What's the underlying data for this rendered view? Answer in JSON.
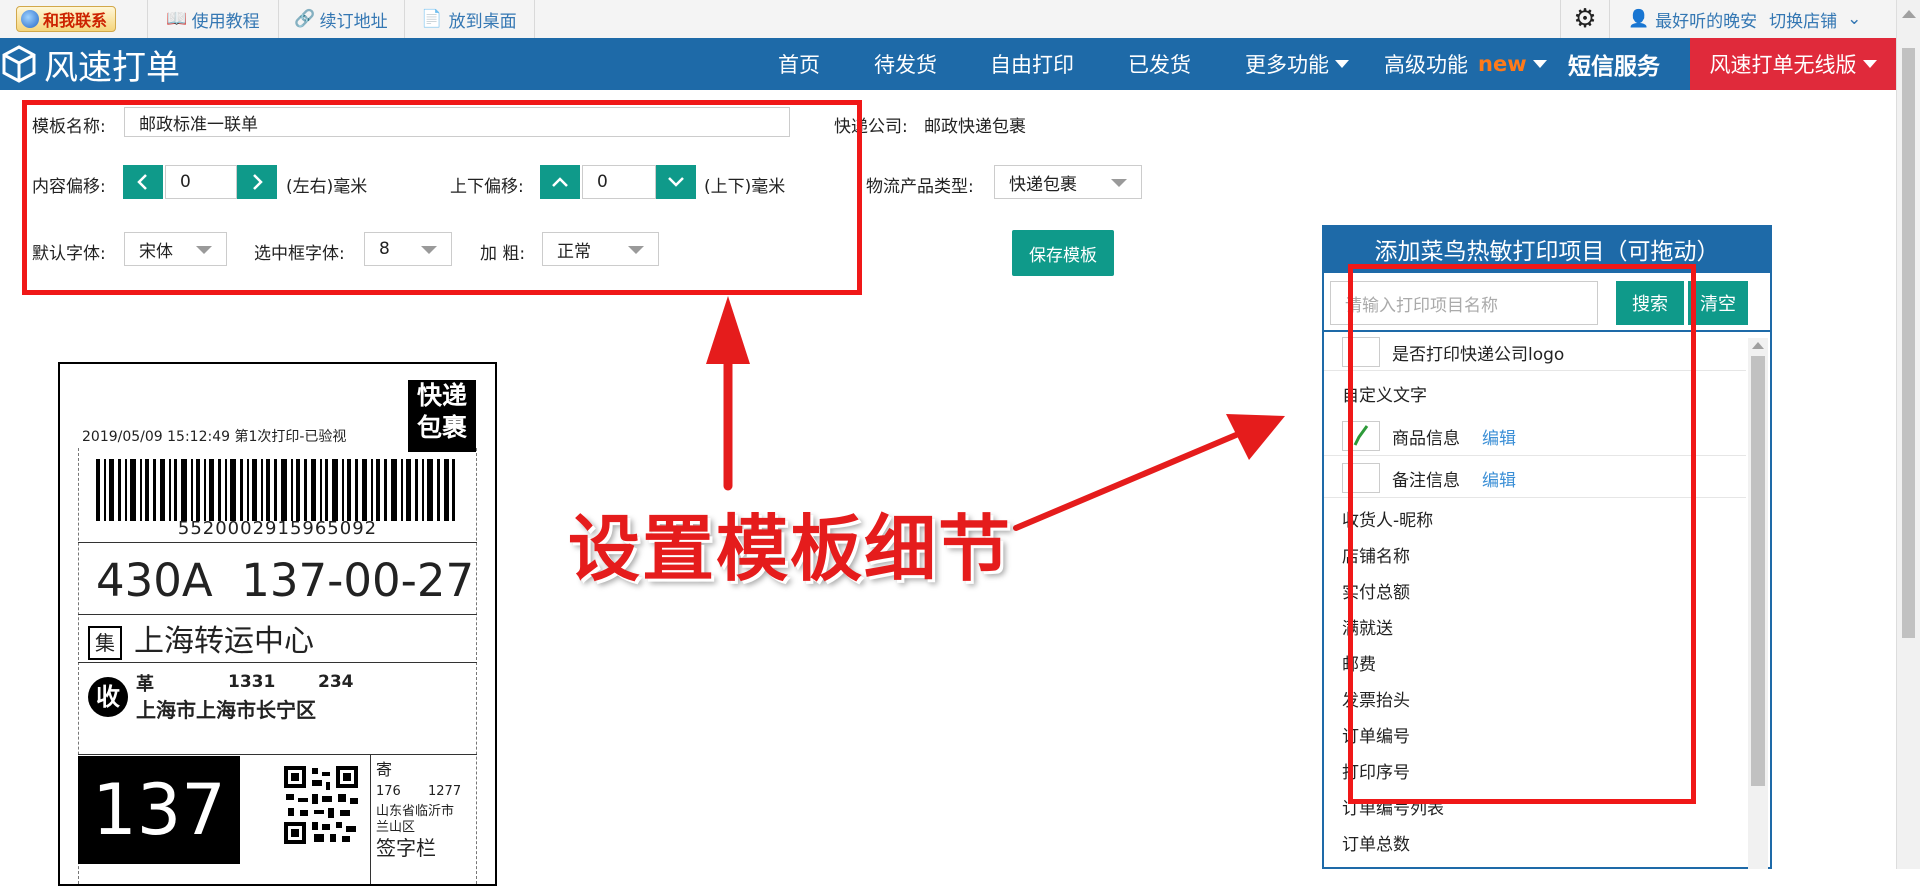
{
  "topbar": {
    "contact": "和我联系",
    "tutorial": "使用教程",
    "renew": "续订地址",
    "desktop": "放到桌面",
    "user": "最好听的晚安",
    "switch_store": "切换店铺"
  },
  "nav": {
    "brand": "风速打单",
    "items": [
      "首页",
      "待发货",
      "自由打印",
      "已发货",
      "更多功能",
      "高级功能",
      "短信服务"
    ],
    "new_tag": "new",
    "cta": "风速打单无线版"
  },
  "form": {
    "template_name_label": "模板名称:",
    "template_name_value": "邮政标准一联单",
    "courier_label": "快递公司:",
    "courier_value": "邮政快递包裹",
    "content_offset_label": "内容偏移:",
    "content_offset_value": "0",
    "content_offset_unit": "(左右)毫米",
    "vertical_offset_label": "上下偏移:",
    "vertical_offset_value": "0",
    "vertical_offset_unit": "(上下)毫米",
    "product_type_label": "物流产品类型:",
    "product_type_value": "快递包裹",
    "default_font_label": "默认字体:",
    "default_font_value": "宋体",
    "box_font_label": "选中框字体:",
    "box_font_value": "8",
    "bold_label": "加 粗:",
    "bold_value": "正常",
    "save_button": "保存模板"
  },
  "label": {
    "print_info": "2019/05/09 15:12:49 第1次打印-已验视",
    "service_top": "快递",
    "service_bottom": "包裹",
    "barcode_number": "5520002915965092",
    "sort_code": "430A  137-00-27",
    "hub_badge": "集",
    "hub": "上海转运中心",
    "recv_badge": "收",
    "recv_name": "革",
    "recv_phone_1": "1331",
    "recv_phone_2": "234",
    "recv_addr": "上海市上海市长宁区",
    "route_code": "137",
    "sender_tag": "寄",
    "sender_line1": "176",
    "sender_line1b": "1277",
    "sender_line2": "山东省临沂市",
    "sender_line3": "兰山区",
    "sign": "签字栏"
  },
  "annotation": "设置模板细节",
  "panel": {
    "title": "添加菜鸟热敏打印项目（可拖动）",
    "search_placeholder": "请输入打印项目名称",
    "search_button": "搜索",
    "clear_button": "清空",
    "items": [
      {
        "label": "是否打印快递公司logo",
        "checkbox": true,
        "checked": false,
        "edit": ""
      },
      {
        "label": "自定义文字",
        "checkbox": false,
        "checked": false,
        "edit": ""
      },
      {
        "label": "商品信息",
        "checkbox": true,
        "checked": true,
        "edit": "编辑"
      },
      {
        "label": "备注信息",
        "checkbox": true,
        "checked": false,
        "edit": "编辑"
      },
      {
        "label": "收货人-昵称",
        "checkbox": false,
        "checked": false,
        "edit": ""
      },
      {
        "label": "店铺名称",
        "checkbox": false,
        "checked": false,
        "edit": ""
      },
      {
        "label": "实付总额",
        "checkbox": false,
        "checked": false,
        "edit": ""
      },
      {
        "label": "满就送",
        "checkbox": false,
        "checked": false,
        "edit": ""
      },
      {
        "label": "邮费",
        "checkbox": false,
        "checked": false,
        "edit": ""
      },
      {
        "label": "发票抬头",
        "checkbox": false,
        "checked": false,
        "edit": ""
      },
      {
        "label": "订单编号",
        "checkbox": false,
        "checked": false,
        "edit": ""
      },
      {
        "label": "打印序号",
        "checkbox": false,
        "checked": false,
        "edit": ""
      },
      {
        "label": "订单编号列表",
        "checkbox": false,
        "checked": false,
        "edit": ""
      },
      {
        "label": "订单总数",
        "checkbox": false,
        "checked": false,
        "edit": ""
      }
    ]
  },
  "colors": {
    "nav_blue": "#1e6aa8",
    "teal": "#0f9a8a",
    "cta_red": "#e02a3b",
    "annotation_red": "#e51c1c"
  }
}
